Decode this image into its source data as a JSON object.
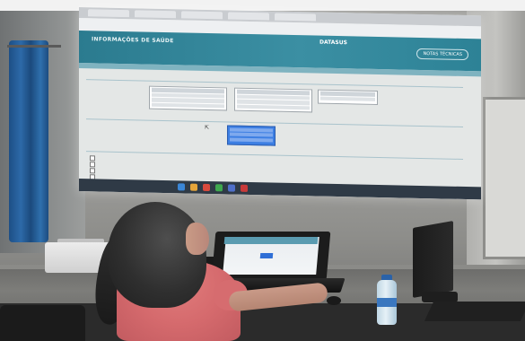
{
  "projection": {
    "site_title": "INFORMAÇÕES DE SAÚDE",
    "brand": "DATASUS",
    "notes_button": "NOTAS TÉCNICAS"
  },
  "colors": {
    "header_teal": "#3b8fa3",
    "selection_blue": "#3d7fe3",
    "shirt_pink": "#d56a6d",
    "curtain_blue": "#2d6aa8"
  }
}
